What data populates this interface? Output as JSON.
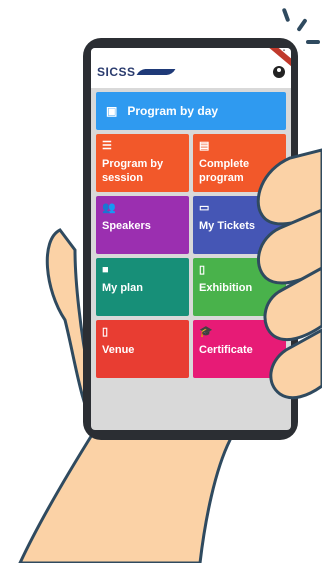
{
  "app": {
    "logo_text": "SICSS"
  },
  "banner": {
    "label": "Program by day",
    "icon": "calendar-icon",
    "color": "#2f9af0"
  },
  "tiles": [
    {
      "label": "Program by\nsession",
      "icon": "list-icon",
      "color": "#f2582a"
    },
    {
      "label": "Complete\nprogram",
      "icon": "document-icon",
      "color": "#f2582a"
    },
    {
      "label": "Speakers",
      "icon": "people-icon",
      "color": "#9b2fb0"
    },
    {
      "label": "My Tickets",
      "icon": "ticket-icon",
      "color": "#4556b5"
    },
    {
      "label": "My plan",
      "icon": "briefcase-icon",
      "color": "#178f78"
    },
    {
      "label": "Exhibition",
      "icon": "map-icon",
      "color": "#49b24b"
    },
    {
      "label": "Venue",
      "icon": "map-icon",
      "color": "#e83d32"
    },
    {
      "label": "Certificate",
      "icon": "graduation-cap-icon",
      "color": "#e71b76"
    }
  ],
  "colors": {
    "phone_frame": "#2b2e33",
    "skin": "#fbd2a6",
    "skin_outline": "#2f4a5f"
  }
}
